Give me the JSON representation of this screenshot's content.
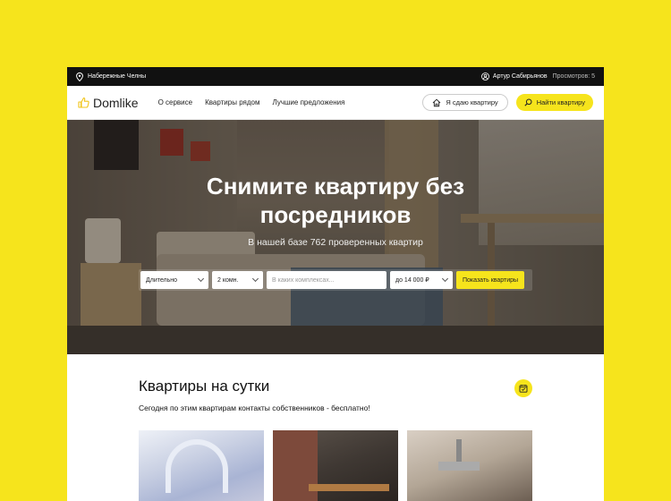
{
  "topbar": {
    "city": "Набережные Челны",
    "user_name": "Артур Сабирьянов",
    "views": "Просмотров: 5"
  },
  "nav": {
    "logo": "Domlike",
    "links": [
      "О сервисе",
      "Квартиры рядом",
      "Лучшие предложения"
    ],
    "rent_out_label": "Я сдаю квартиру",
    "find_label": "Найти квартиру"
  },
  "hero": {
    "title_line1": "Снимите квартиру без",
    "title_line2": "посредников",
    "subtitle": "В нашей базе 762 проверенных квартир"
  },
  "search": {
    "term": "Длительно",
    "rooms": "2 комн.",
    "complex_placeholder": "В каких комплексах...",
    "price": "до 14 000 ₽",
    "submit_label": "Показать квартиры"
  },
  "section": {
    "title": "Квартиры на сутки",
    "subtitle": "Сегодня по этим квартирам контакты собственников - бесплатно!"
  },
  "colors": {
    "accent": "#f6e41c",
    "topbar_bg": "#111111"
  }
}
